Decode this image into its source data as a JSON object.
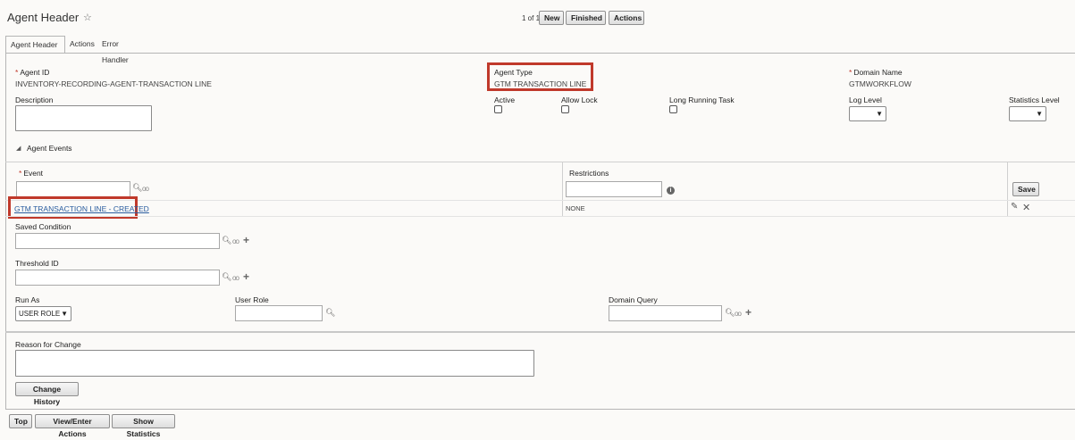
{
  "header": {
    "title": "Agent Header",
    "pager": "1 of 1",
    "buttons": {
      "new": "New",
      "finished": "Finished",
      "actions": "Actions"
    }
  },
  "tabs": [
    {
      "label": "Agent Header"
    },
    {
      "label": "Actions"
    },
    {
      "label": "Error Handler"
    }
  ],
  "form": {
    "agent_id_label": "Agent ID",
    "agent_id_value": "INVENTORY-RECORDING-AGENT-TRANSACTION LINE",
    "agent_type_label": "Agent Type",
    "agent_type_value": "GTM TRANSACTION LINE",
    "domain_name_label": "Domain Name",
    "domain_name_value": "GTMWORKFLOW",
    "description_label": "Description",
    "active_label": "Active",
    "allow_lock_label": "Allow Lock",
    "long_running_label": "Long Running Task",
    "log_level_label": "Log Level",
    "statistics_level_label": "Statistics Level",
    "required_mark": "*"
  },
  "events": {
    "section_label": "Agent Events",
    "event_label": "Event",
    "restrictions_label": "Restrictions",
    "save_label": "Save",
    "row": {
      "event": "GTM TRANSACTION LINE - CREATED",
      "restriction": "NONE"
    }
  },
  "conditions": {
    "saved_condition_label": "Saved Condition",
    "threshold_id_label": "Threshold ID",
    "run_as_label": "Run As",
    "run_as_value": "USER ROLE",
    "user_role_label": "User Role",
    "domain_query_label": "Domain Query"
  },
  "change": {
    "reason_label": "Reason for Change",
    "history_button": "Change History"
  },
  "footer": {
    "top": "Top",
    "view_enter_actions": "View/Enter Actions",
    "show_statistics": "Show Statistics"
  },
  "colors": {
    "highlight": "#c0392b",
    "link": "#2a5d9f"
  }
}
